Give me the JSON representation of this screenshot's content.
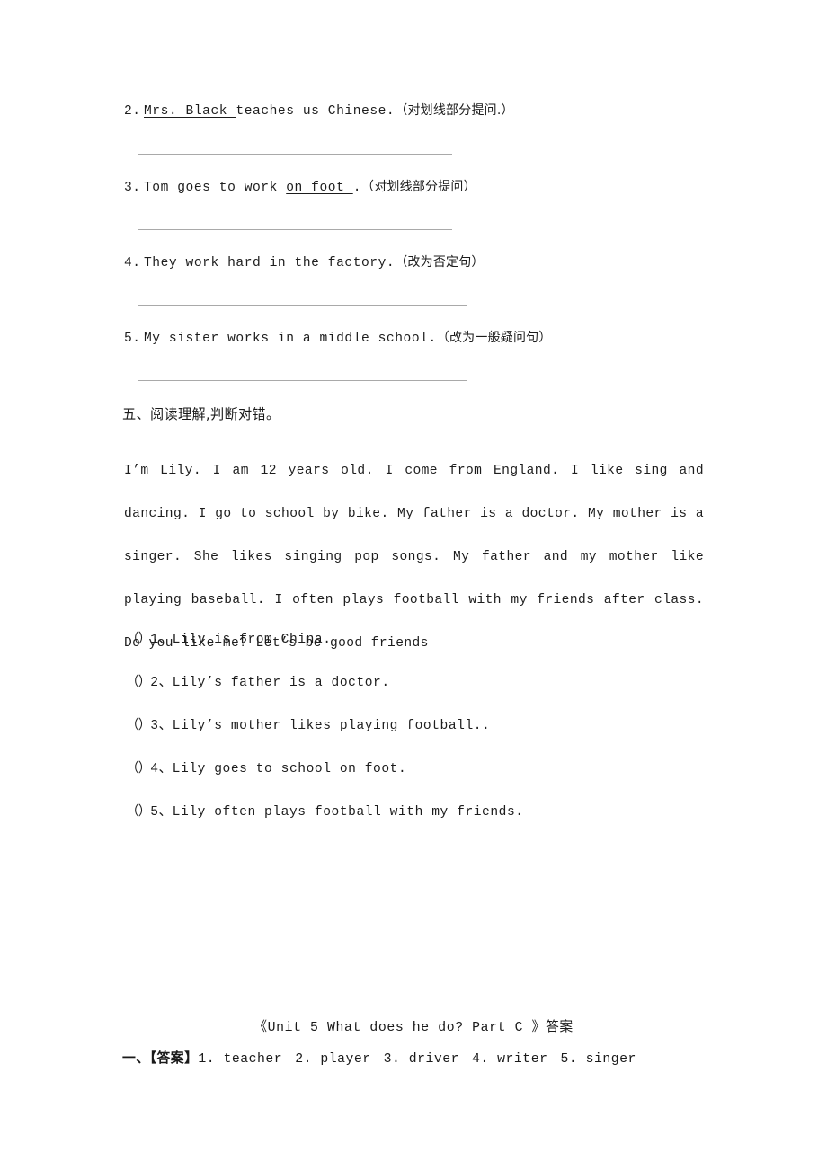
{
  "document": {
    "type": "worksheet-page",
    "background_color": "#ffffff",
    "text_color": "#1d1d1d",
    "rule_color": "#9a9a9a"
  },
  "questions": [
    {
      "number": "2.",
      "underlined": "Mrs. Black ",
      "text_before": "",
      "text_after": "teaches us Chinese.",
      "instruction": "（对划线部分提问.）"
    },
    {
      "number": "3.",
      "underlined": "on foot ",
      "text_before": "Tom goes to work ",
      "text_after": ".",
      "instruction": "（对划线部分提问）"
    },
    {
      "number": "4.",
      "underlined": "",
      "text_before": "They work hard in the factory.",
      "text_after": "",
      "instruction": "（改为否定句）"
    },
    {
      "number": "5.",
      "underlined": "",
      "text_before": "My sister works in a middle school.",
      "text_after": "",
      "instruction": "（改为一般疑问句）"
    }
  ],
  "section": {
    "heading": "五、阅读理解,判断对错。"
  },
  "passage": {
    "text": "I’m Lily. I am 12 years old. I come from England. I like sing and dancing. I go to school by bike. My father is a doctor. My mother is a singer. She likes singing pop songs. My father and my mother like playing baseball. I often plays football with my friends after class. Do you like me? Let’s be good friends"
  },
  "true_false_items": [
    {
      "paren": "（）",
      "index": "1",
      "sep": "、",
      "text": "Lily is from China."
    },
    {
      "paren": "（）",
      "index": "2",
      "sep": "、",
      "text": "Lily’s father is a doctor."
    },
    {
      "paren": "（）",
      "index": "3",
      "sep": "、",
      "text": "Lily’s mother likes playing football.."
    },
    {
      "paren": "（）",
      "index": "4",
      "sep": "、",
      "text": "Lily goes to school on foot."
    },
    {
      "paren": "（）",
      "index": "5",
      "sep": "、",
      "text": "Lily often plays football with my friends."
    }
  ],
  "footer": {
    "title_open": "《",
    "title_main": "Unit 5 What does he do? Part C ",
    "title_close": "》",
    "title_suffix": "答案",
    "answer_label": "一、【答案】",
    "answers": [
      "1. teacher",
      "2. player",
      "3. driver",
      "4. writer",
      "5. singer"
    ]
  }
}
